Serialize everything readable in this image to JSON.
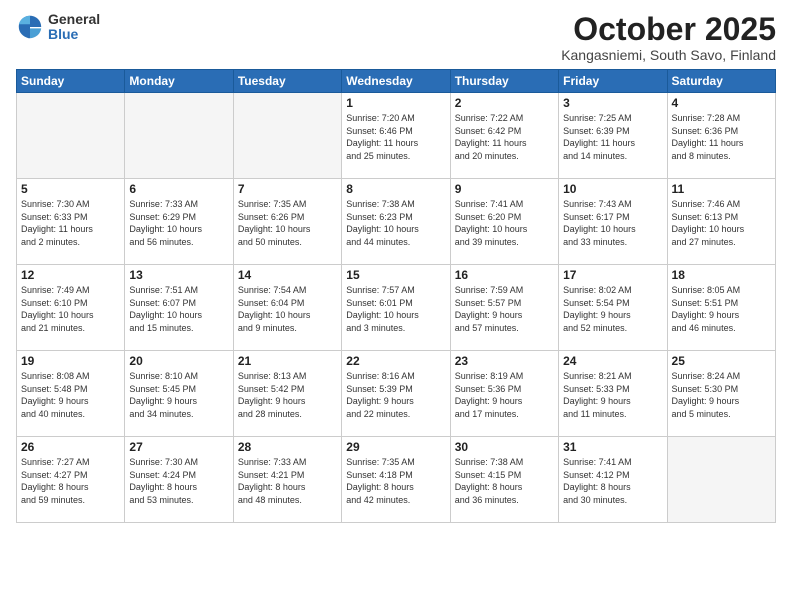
{
  "logo": {
    "general": "General",
    "blue": "Blue"
  },
  "header": {
    "month": "October 2025",
    "location": "Kangasniemi, South Savo, Finland"
  },
  "days_of_week": [
    "Sunday",
    "Monday",
    "Tuesday",
    "Wednesday",
    "Thursday",
    "Friday",
    "Saturday"
  ],
  "weeks": [
    [
      {
        "day": "",
        "info": ""
      },
      {
        "day": "",
        "info": ""
      },
      {
        "day": "",
        "info": ""
      },
      {
        "day": "1",
        "info": "Sunrise: 7:20 AM\nSunset: 6:46 PM\nDaylight: 11 hours\nand 25 minutes."
      },
      {
        "day": "2",
        "info": "Sunrise: 7:22 AM\nSunset: 6:42 PM\nDaylight: 11 hours\nand 20 minutes."
      },
      {
        "day": "3",
        "info": "Sunrise: 7:25 AM\nSunset: 6:39 PM\nDaylight: 11 hours\nand 14 minutes."
      },
      {
        "day": "4",
        "info": "Sunrise: 7:28 AM\nSunset: 6:36 PM\nDaylight: 11 hours\nand 8 minutes."
      }
    ],
    [
      {
        "day": "5",
        "info": "Sunrise: 7:30 AM\nSunset: 6:33 PM\nDaylight: 11 hours\nand 2 minutes."
      },
      {
        "day": "6",
        "info": "Sunrise: 7:33 AM\nSunset: 6:29 PM\nDaylight: 10 hours\nand 56 minutes."
      },
      {
        "day": "7",
        "info": "Sunrise: 7:35 AM\nSunset: 6:26 PM\nDaylight: 10 hours\nand 50 minutes."
      },
      {
        "day": "8",
        "info": "Sunrise: 7:38 AM\nSunset: 6:23 PM\nDaylight: 10 hours\nand 44 minutes."
      },
      {
        "day": "9",
        "info": "Sunrise: 7:41 AM\nSunset: 6:20 PM\nDaylight: 10 hours\nand 39 minutes."
      },
      {
        "day": "10",
        "info": "Sunrise: 7:43 AM\nSunset: 6:17 PM\nDaylight: 10 hours\nand 33 minutes."
      },
      {
        "day": "11",
        "info": "Sunrise: 7:46 AM\nSunset: 6:13 PM\nDaylight: 10 hours\nand 27 minutes."
      }
    ],
    [
      {
        "day": "12",
        "info": "Sunrise: 7:49 AM\nSunset: 6:10 PM\nDaylight: 10 hours\nand 21 minutes."
      },
      {
        "day": "13",
        "info": "Sunrise: 7:51 AM\nSunset: 6:07 PM\nDaylight: 10 hours\nand 15 minutes."
      },
      {
        "day": "14",
        "info": "Sunrise: 7:54 AM\nSunset: 6:04 PM\nDaylight: 10 hours\nand 9 minutes."
      },
      {
        "day": "15",
        "info": "Sunrise: 7:57 AM\nSunset: 6:01 PM\nDaylight: 10 hours\nand 3 minutes."
      },
      {
        "day": "16",
        "info": "Sunrise: 7:59 AM\nSunset: 5:57 PM\nDaylight: 9 hours\nand 57 minutes."
      },
      {
        "day": "17",
        "info": "Sunrise: 8:02 AM\nSunset: 5:54 PM\nDaylight: 9 hours\nand 52 minutes."
      },
      {
        "day": "18",
        "info": "Sunrise: 8:05 AM\nSunset: 5:51 PM\nDaylight: 9 hours\nand 46 minutes."
      }
    ],
    [
      {
        "day": "19",
        "info": "Sunrise: 8:08 AM\nSunset: 5:48 PM\nDaylight: 9 hours\nand 40 minutes."
      },
      {
        "day": "20",
        "info": "Sunrise: 8:10 AM\nSunset: 5:45 PM\nDaylight: 9 hours\nand 34 minutes."
      },
      {
        "day": "21",
        "info": "Sunrise: 8:13 AM\nSunset: 5:42 PM\nDaylight: 9 hours\nand 28 minutes."
      },
      {
        "day": "22",
        "info": "Sunrise: 8:16 AM\nSunset: 5:39 PM\nDaylight: 9 hours\nand 22 minutes."
      },
      {
        "day": "23",
        "info": "Sunrise: 8:19 AM\nSunset: 5:36 PM\nDaylight: 9 hours\nand 17 minutes."
      },
      {
        "day": "24",
        "info": "Sunrise: 8:21 AM\nSunset: 5:33 PM\nDaylight: 9 hours\nand 11 minutes."
      },
      {
        "day": "25",
        "info": "Sunrise: 8:24 AM\nSunset: 5:30 PM\nDaylight: 9 hours\nand 5 minutes."
      }
    ],
    [
      {
        "day": "26",
        "info": "Sunrise: 7:27 AM\nSunset: 4:27 PM\nDaylight: 8 hours\nand 59 minutes."
      },
      {
        "day": "27",
        "info": "Sunrise: 7:30 AM\nSunset: 4:24 PM\nDaylight: 8 hours\nand 53 minutes."
      },
      {
        "day": "28",
        "info": "Sunrise: 7:33 AM\nSunset: 4:21 PM\nDaylight: 8 hours\nand 48 minutes."
      },
      {
        "day": "29",
        "info": "Sunrise: 7:35 AM\nSunset: 4:18 PM\nDaylight: 8 hours\nand 42 minutes."
      },
      {
        "day": "30",
        "info": "Sunrise: 7:38 AM\nSunset: 4:15 PM\nDaylight: 8 hours\nand 36 minutes."
      },
      {
        "day": "31",
        "info": "Sunrise: 7:41 AM\nSunset: 4:12 PM\nDaylight: 8 hours\nand 30 minutes."
      },
      {
        "day": "",
        "info": ""
      }
    ]
  ]
}
